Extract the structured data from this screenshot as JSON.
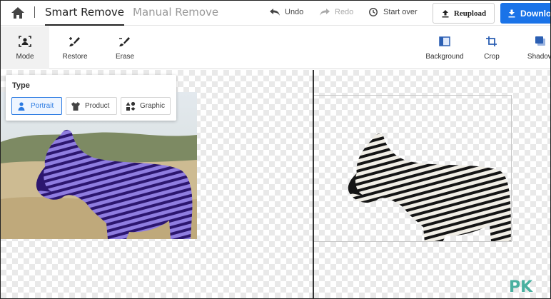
{
  "header": {
    "tabs": [
      {
        "label": "Smart Remove",
        "active": true
      },
      {
        "label": "Manual Remove",
        "active": false
      }
    ],
    "undo_label": "Undo",
    "redo_label": "Redo",
    "start_over_label": "Start over",
    "reupload_label": "Reupload",
    "download_label": "Download"
  },
  "toolbar": {
    "left_tools": [
      {
        "label": "Mode",
        "icon": "portrait-mode-icon",
        "active": true
      },
      {
        "label": "Restore",
        "icon": "brush-plus-icon"
      },
      {
        "label": "Erase",
        "icon": "brush-minus-icon"
      }
    ],
    "right_tools": [
      {
        "label": "Background",
        "icon": "background-icon"
      },
      {
        "label": "Crop",
        "icon": "crop-icon"
      },
      {
        "label": "Shadow",
        "icon": "shadow-icon"
      }
    ]
  },
  "type_panel": {
    "title": "Type",
    "options": [
      {
        "label": "Portrait",
        "icon": "person-icon",
        "selected": true
      },
      {
        "label": "Product",
        "icon": "shirt-icon",
        "selected": false
      },
      {
        "label": "Graphic",
        "icon": "shapes-icon",
        "selected": false
      }
    ]
  },
  "watermark": "PK",
  "colors": {
    "accent": "#1a73e8",
    "selection_tint": "#5a3fb8",
    "watermark": "#4ab0a0"
  }
}
